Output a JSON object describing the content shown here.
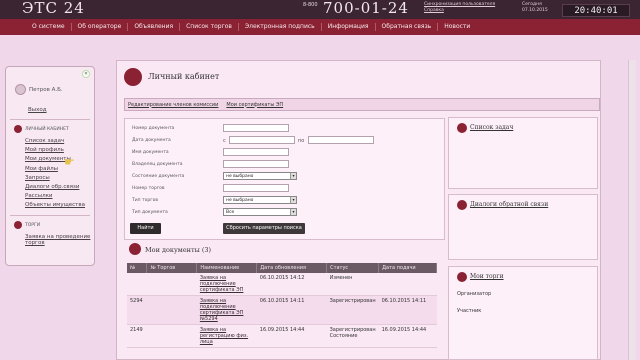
{
  "header": {
    "logo": "ЭТС 24",
    "phone_prefix": "8-800",
    "phone": "700-01-24",
    "sync_link": "Синхронизация пользователя Справка",
    "today_label": "Сегодня 07.10.2015",
    "clock": "20:40:01"
  },
  "nav": [
    "О системе",
    "Об операторе",
    "Объявления",
    "Список торгов",
    "Электронная подпись",
    "Информация",
    "Обратная связь",
    "Новости"
  ],
  "sidebar": {
    "collapse": "«",
    "user": "Петров А.Б.",
    "logout": "Выход",
    "section_cabinet": "Личный кабинет",
    "cabinet_links": [
      "Список задач",
      "Мой профиль",
      "Мои документы",
      "Мои файлы",
      "Запросы",
      "Диалоги обр.связи",
      "Рассылки",
      "Объекты имущества"
    ],
    "section_trades": "Торги",
    "trade_link": "Заявка на проведение торгов"
  },
  "main": {
    "title": "Личный кабинет",
    "tabs": [
      "Редактирование членов комиссии",
      "Мои сертификаты ЭП"
    ],
    "filter": {
      "labels": [
        "Номер документа",
        "Дата документа",
        "Имя документа",
        "Владелец документа",
        "Состояние документа",
        "Номер торгов",
        "Тип торгов",
        "Тип документа"
      ],
      "from": "с",
      "to": "по",
      "state_value": "не выбрано",
      "trade_type_value": "не выбрано",
      "doc_type_value": "Все",
      "find_button": "Найти",
      "reset_button": "Сбросить параметры поиска"
    },
    "docs_title": "Мои документы",
    "docs_count": "(3)",
    "table": {
      "headers": [
        "№",
        "№ Торгов",
        "Наименование",
        "Дата обновления",
        "Статус",
        "Дата подачи"
      ],
      "rows": [
        [
          "",
          "",
          "Заявка на подключение сертификата ЭП",
          "06.10.2015 14:12",
          "Изменен",
          ""
        ],
        [
          "5294",
          "",
          "Заявка на подключение сертификата ЭП №5294",
          "06.10.2015 14:11",
          "Зарегистрирован",
          "06.10.2015 14:11"
        ],
        [
          "2149",
          "",
          "Заявка на регистрацию физ. лица",
          "16.09.2015 14:44",
          "Зарегистрирован Состояние",
          "16.09.2015 14:44"
        ]
      ]
    }
  },
  "right": {
    "tasks_title": "Список задач",
    "dialogs_title": "Диалоги обратной связи",
    "trades_title": "Мои торги",
    "trades_items": [
      "Организатор",
      "Участник"
    ]
  }
}
